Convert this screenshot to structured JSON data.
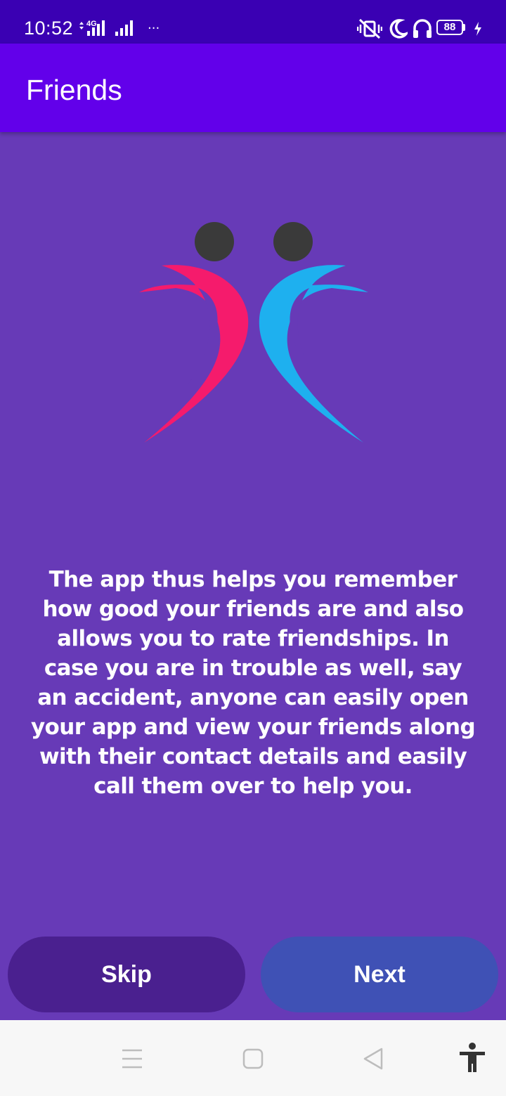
{
  "status_bar": {
    "time": "10:52",
    "network_label": "4G",
    "overflow_dots": "···",
    "battery_level": "88",
    "icons": [
      "mute-vibrate-icon",
      "moon-icon",
      "headphones-icon",
      "battery-icon",
      "charging-icon"
    ]
  },
  "app_bar": {
    "title": "Friends"
  },
  "onboarding": {
    "description": "The app thus helps you remember how good your friends are and also allows you to rate friendships. In case you are in trouble as well, say an accident, anyone can easily open your app and view your friends along with their contact details and easily call them over to help you."
  },
  "buttons": {
    "skip_label": "Skip",
    "next_label": "Next"
  },
  "navigation_bar": {
    "icons": [
      "menu-icon",
      "home-square-icon",
      "back-triangle-icon",
      "accessibility-icon"
    ]
  },
  "colors": {
    "status_bar": "#3A00B3",
    "app_bar": "#6200EA",
    "background": "#673AB7",
    "skip_button": "#4A208F",
    "next_button": "#3F51B5",
    "logo_left": "#F51B6C",
    "logo_right": "#1EB0EF",
    "logo_heads": "#3A3A3A"
  }
}
